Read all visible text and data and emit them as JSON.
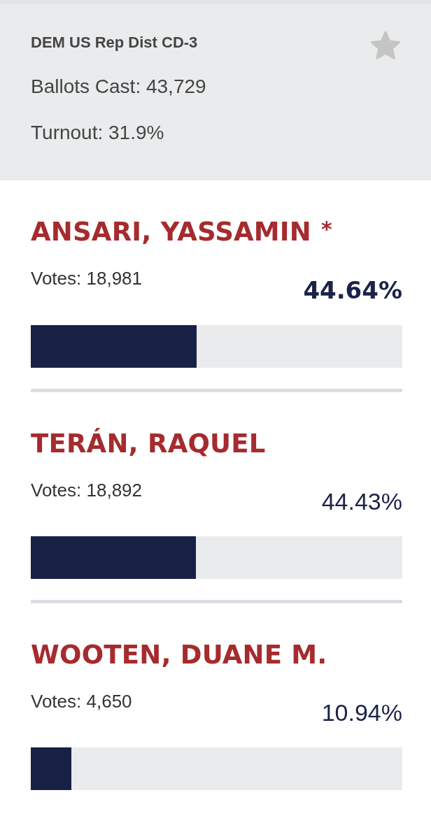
{
  "race": {
    "title": "DEM US Rep Dist CD-3",
    "starred": false,
    "ballots_cast": "Ballots Cast: 43,729",
    "turnout": "Turnout: 31.9%"
  },
  "candidates": [
    {
      "name": "ANSARI, YASSAMIN",
      "marker": "*",
      "votes": "Votes: 18,981",
      "percent": "44.64%",
      "leading": true,
      "level": 0.4464
    },
    {
      "name": "TERÁN, RAQUEL",
      "votes": "Votes: 18,892",
      "percent": "44.43%",
      "leading": false,
      "level": 0.4443
    },
    {
      "name": "WOOTEN, DUANE M.",
      "votes": "Votes: 4,650",
      "percent": "10.94%",
      "leading": false,
      "level": 0.1094
    }
  ]
}
